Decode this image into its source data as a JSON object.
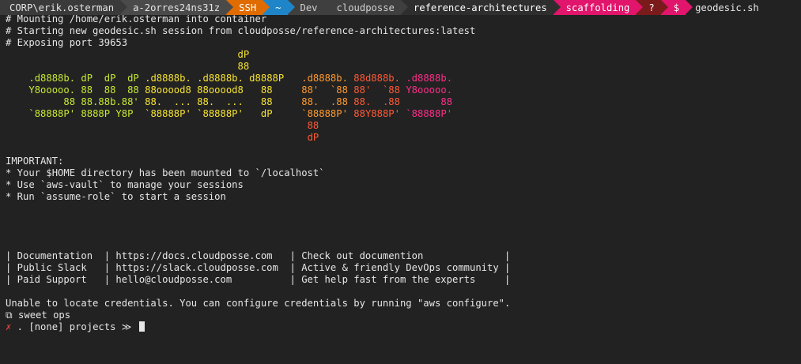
{
  "prompt_bar": {
    "segments": [
      {
        "id": "user",
        "text": "CORP\\erik.osterman",
        "bg": "#3a3a3a",
        "fg": "#e6e6e6"
      },
      {
        "id": "host",
        "text": "a-2orres24ns31z",
        "bg": "#4a4a4a",
        "fg": "#e6e6e6"
      },
      {
        "id": "ssh",
        "text": "SSH",
        "bg": "#e06c00",
        "fg": "#ffffff"
      },
      {
        "id": "home",
        "text": "~",
        "bg": "#1e86c8",
        "fg": "#ffffff"
      },
      {
        "id": "path-dev",
        "text": "Dev",
        "bg": "#3f3f3f",
        "fg": "#d0d0d0"
      },
      {
        "id": "path-cloudposse",
        "text": "cloudposse",
        "bg": "#3f3f3f",
        "fg": "#d0d0d0"
      },
      {
        "id": "path-refarch",
        "text": "reference-architectures",
        "bg": "#2e2e2e",
        "fg": "#ffffff"
      },
      {
        "id": "git-branch",
        "text": "scaffolding",
        "bg": "#e0156b",
        "fg": "#ffffff"
      },
      {
        "id": "status",
        "text": "?",
        "bg": "#7a1a1a",
        "fg": "#ffffff"
      },
      {
        "id": "dollar",
        "text": "$",
        "bg": "#e0156b",
        "fg": "#ffffff"
      }
    ],
    "command": "geodesic.sh"
  },
  "terminal": {
    "messages": [
      "# Mounting /home/erik.osterman into container",
      "# Starting new geodesic.sh session from cloudposse/reference-architectures:latest",
      "# Exposing port 39653"
    ],
    "banner": [
      [
        {
          "t": "                                        ",
          "c": ""
        },
        {
          "t": "dP",
          "c": "c-yellow"
        }
      ],
      [
        {
          "t": "                                        ",
          "c": ""
        },
        {
          "t": "88",
          "c": "c-yellow"
        }
      ],
      [
        {
          "t": "    ",
          "c": ""
        },
        {
          "t": ".d8888b. dP  dP  dP ",
          "c": "c-lime"
        },
        {
          "t": ".d8888b. .d8888b. d8888P   ",
          "c": "c-yellow"
        },
        {
          "t": ".d8888b. ",
          "c": "c-orange"
        },
        {
          "t": "88d888b. ",
          "c": "c-red"
        },
        {
          "t": ".d8888b.",
          "c": "c-pink"
        }
      ],
      [
        {
          "t": "    ",
          "c": ""
        },
        {
          "t": "Y8ooooo. 88  88  88 ",
          "c": "c-lime"
        },
        {
          "t": "88ooood8 88ooood8   88     ",
          "c": "c-yellow"
        },
        {
          "t": "88'  `88 ",
          "c": "c-orange"
        },
        {
          "t": "88'  `88 ",
          "c": "c-red"
        },
        {
          "t": "Y8ooooo.",
          "c": "c-pink"
        }
      ],
      [
        {
          "t": "          ",
          "c": ""
        },
        {
          "t": "88 88.88b.88' ",
          "c": "c-lime"
        },
        {
          "t": "88.  ... 88.  ...   88     ",
          "c": "c-yellow"
        },
        {
          "t": "88.  .88 ",
          "c": "c-orange"
        },
        {
          "t": "88.  .88 ",
          "c": "c-red"
        },
        {
          "t": "      88",
          "c": "c-pink"
        }
      ],
      [
        {
          "t": "    ",
          "c": ""
        },
        {
          "t": "`88888P' 8888P Y8P  ",
          "c": "c-lime"
        },
        {
          "t": "`88888P' `88888P'   dP     ",
          "c": "c-yellow"
        },
        {
          "t": "`88888P' ",
          "c": "c-orange"
        },
        {
          "t": "88Y888P' ",
          "c": "c-red"
        },
        {
          "t": "`88888P'",
          "c": "c-pink"
        }
      ],
      [
        {
          "t": "                                                    ",
          "c": ""
        },
        {
          "t": "88",
          "c": "c-red"
        }
      ],
      [
        {
          "t": "                                                    ",
          "c": ""
        },
        {
          "t": "dP",
          "c": "c-red"
        }
      ]
    ],
    "important_title": "IMPORTANT:",
    "important_items": [
      "* Your $HOME directory has been mounted to `/localhost`",
      "* Use `aws-vault` to manage your sessions",
      "* Run `assume-role` to start a session"
    ],
    "links_table": [
      "| Documentation  | https://docs.cloudposse.com   | Check out documention              |",
      "| Public Slack   | https://slack.cloudposse.com  | Active & friendly DevOps community |",
      "| Paid Support   | hello@cloudposse.com          | Get help fast from the experts     |"
    ],
    "credentials_warning": "Unable to locate credentials. You can configure credentials by running \"aws configure\".",
    "ops_line_icon": "⧉",
    "ops_line_text": " sweet ops",
    "prompt_status": "✗",
    "prompt_text": " . [none] projects ≫ "
  }
}
